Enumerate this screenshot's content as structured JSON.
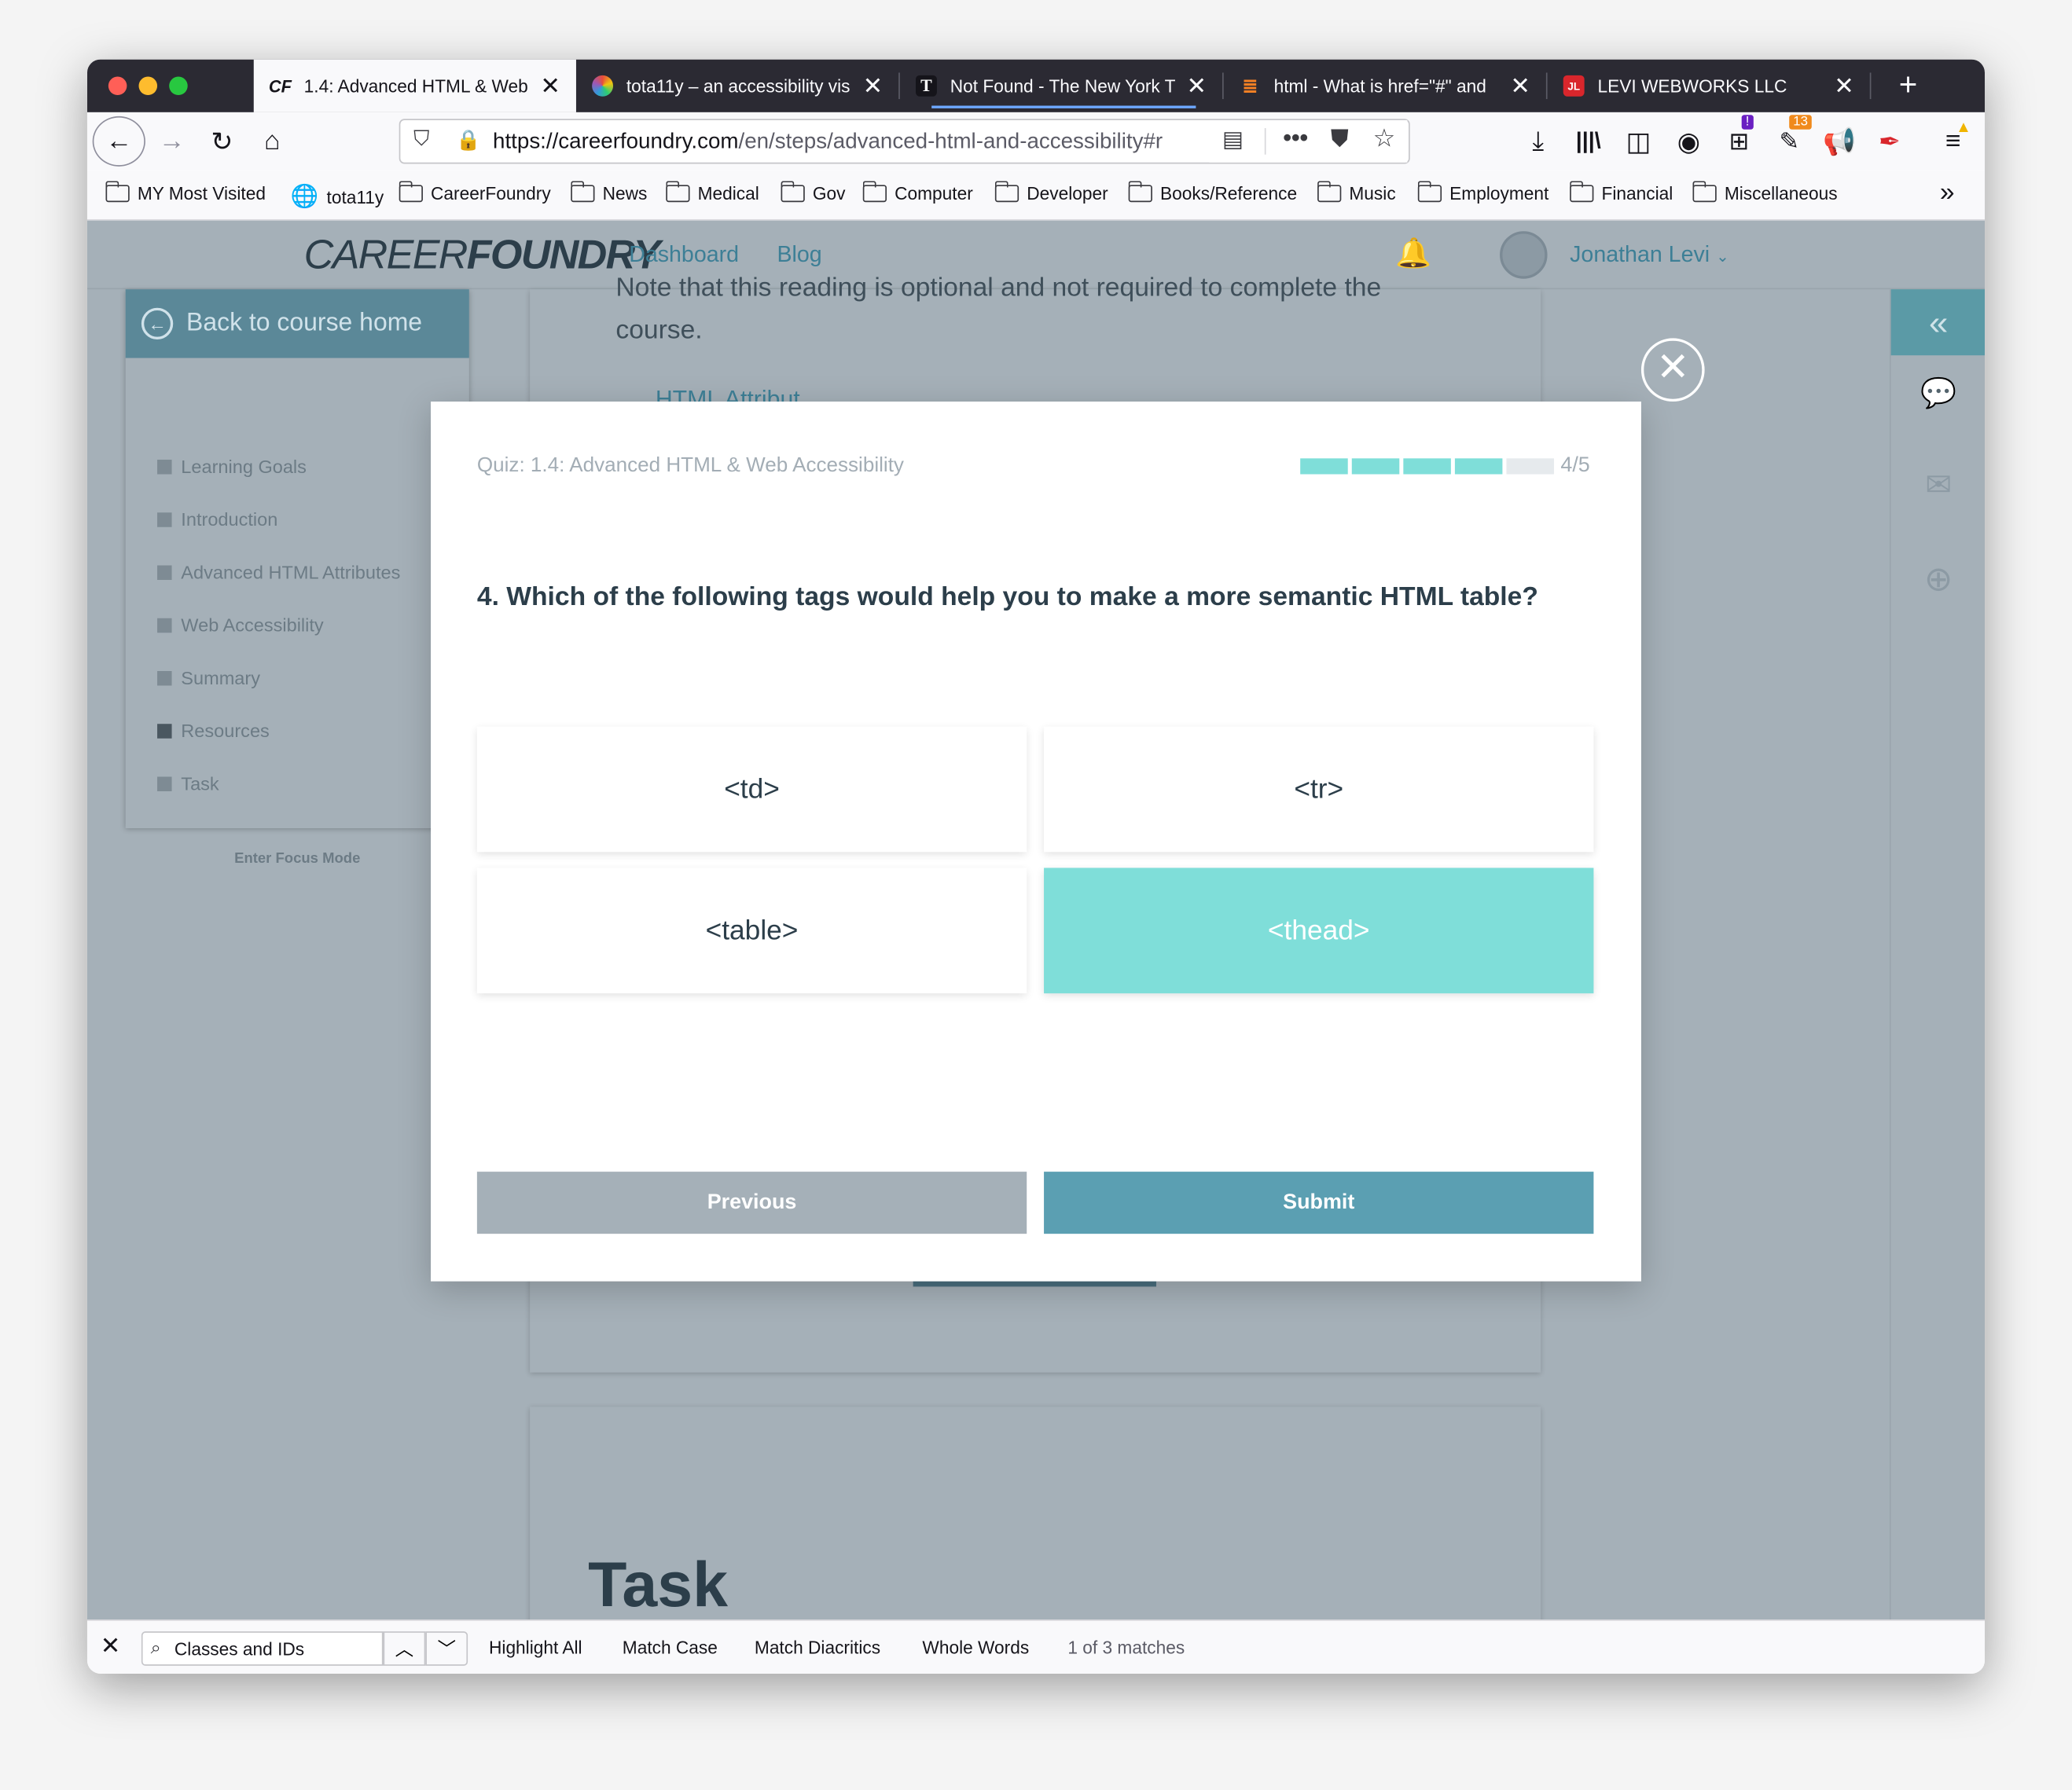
{
  "browser": {
    "tabs": [
      {
        "favicon": "CF",
        "title": "1.4: Advanced HTML & Web"
      },
      {
        "favicon": "",
        "title": "tota11y – an accessibility vis"
      },
      {
        "favicon": "T",
        "title": "Not Found - The New York T"
      },
      {
        "favicon": "",
        "title": "html - What is href=\"#\" and"
      },
      {
        "favicon": "JL",
        "title": "LEVI WEBWORKS LLC"
      }
    ],
    "url_host": "https://careerfoundry.com",
    "url_path": "/en/steps/advanced-html-and-accessibility#r",
    "badges": {
      "ext1": "!",
      "ext2": "13"
    },
    "bookmarks": [
      "MY Most Visited",
      "tota11y",
      "CareerFoundry",
      "News",
      "Medical",
      "Gov",
      "Computer",
      "Developer",
      "Books/Reference",
      "Music",
      "Employment",
      "Financial",
      "Miscellaneous"
    ],
    "colors": {
      "titlebar": "#2b2a33",
      "accent": "#0060df"
    }
  },
  "site": {
    "logo_light": "CAREER",
    "logo_bold": "FOUNDRY",
    "nav": {
      "dashboard": "Dashboard",
      "blog": "Blog"
    },
    "user": "Jonathan Levi",
    "colors": {
      "teal": "#5b9aa6",
      "overlay": "#a5b0b8",
      "selected": "#7fded9"
    }
  },
  "sidebar": {
    "back": "Back to course home",
    "items": [
      "Learning Goals",
      "Introduction",
      "Advanced HTML Attributes",
      "Web Accessibility",
      "Summary",
      "Resources",
      "Task"
    ],
    "focus": "Enter Focus Mode"
  },
  "article": {
    "partial_line": "Note that this reading is optional and not required to complete the",
    "course_word": "course.",
    "link_partial": "HTML Attribut",
    "task_heading": "Task"
  },
  "quiz": {
    "title": "Quiz: 1.4: Advanced HTML & Web Accessibility",
    "progress": {
      "current": 4,
      "total": 5,
      "label": "4/5"
    },
    "question": "4. Which of the following tags would help you to make a more semantic HTML table?",
    "answers": [
      "<td>",
      "<tr>",
      "<table>",
      "<thead>"
    ],
    "selected": "<thead>",
    "previous": "Previous",
    "submit": "Submit"
  },
  "findbar": {
    "query": "Classes and IDs",
    "highlight_all": "Highlight All",
    "match_case": "Match Case",
    "match_diacritics": "Match Diacritics",
    "whole_words": "Whole Words",
    "status": "1 of 3 matches"
  }
}
